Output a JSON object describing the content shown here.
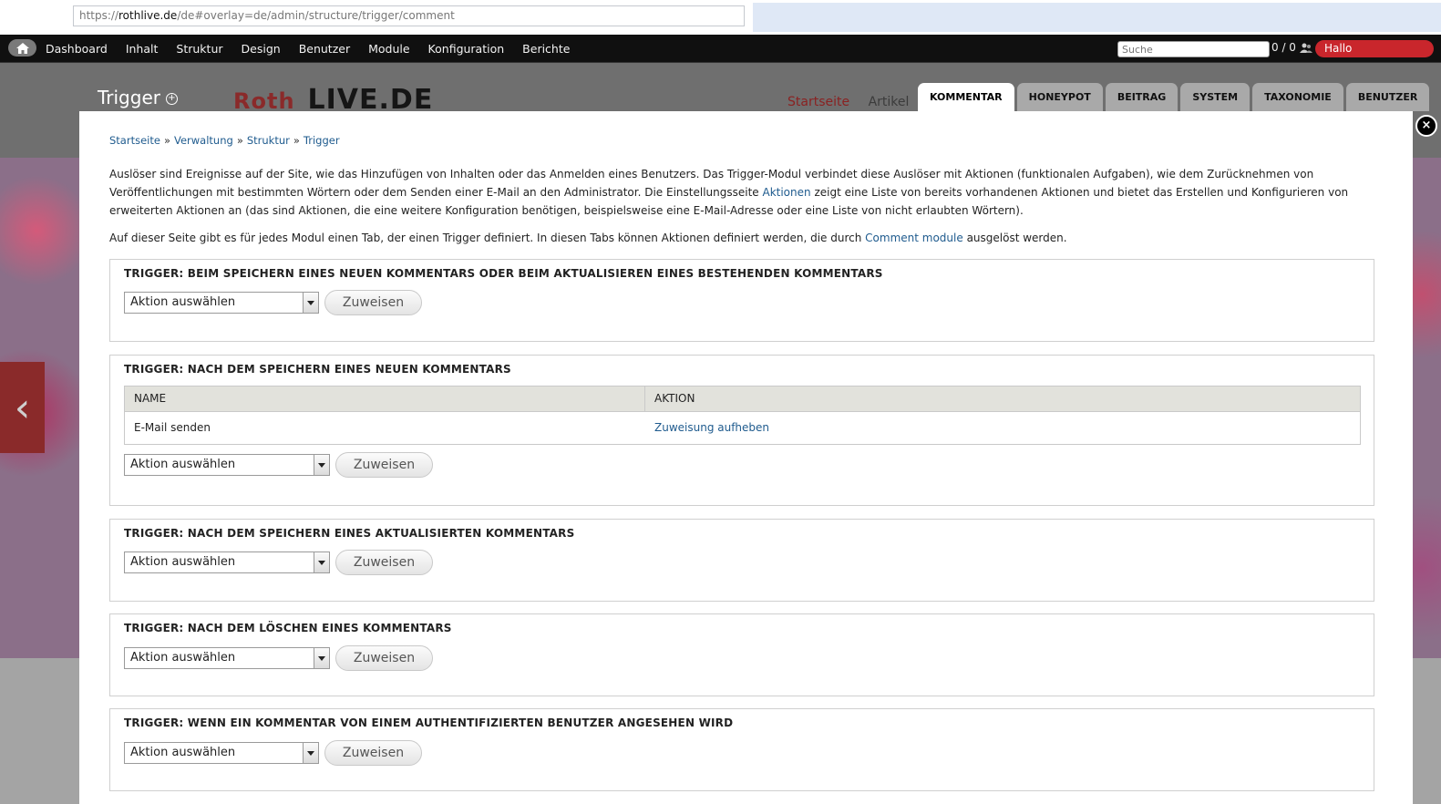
{
  "browser": {
    "url_scheme": "https://",
    "url_host": "rothlive.de",
    "url_path": "/de#overlay=de/admin/structure/trigger/comment"
  },
  "toolbar": {
    "home_icon": "home-icon",
    "menu": [
      "Dashboard",
      "Inhalt",
      "Struktur",
      "Design",
      "Benutzer",
      "Module",
      "Konfiguration",
      "Berichte"
    ],
    "search_placeholder": "Suche",
    "users_count": "0 / 0",
    "hello_label": "Hallo"
  },
  "site": {
    "logo_roth": "Roth",
    "logo_main": "LIVE.DE",
    "nav": [
      "Startseite",
      "Artikel"
    ]
  },
  "overlay": {
    "title": "Trigger",
    "tabs": [
      "KOMMENTAR",
      "HONEYPOT",
      "BEITRAG",
      "SYSTEM",
      "TAXONOMIE",
      "BENUTZER"
    ],
    "active_tab": "KOMMENTAR",
    "close_label": "×",
    "breadcrumb": [
      "Startseite",
      "Verwaltung",
      "Struktur",
      "Trigger"
    ],
    "breadcrumb_sep": "»",
    "intro": {
      "part1": "Auslöser sind Ereignisse auf der Site, wie das Hinzufügen von Inhalten oder das Anmelden eines Benutzers. Das Trigger-Modul verbindet diese Auslöser mit Aktionen (funktionalen Aufgaben), wie dem Zurücknehmen von Veröffentlichungen mit bestimmten Wörtern oder dem Senden einer E-Mail an den Administrator. Die Einstellungsseite ",
      "link": "Aktionen",
      "part2": " zeigt eine Liste von bereits vorhandenen Aktionen und bietet das Erstellen und Konfigurieren von erweiterten Aktionen an (das sind Aktionen, die eine weitere Konfiguration benötigen, beispielsweise eine E-Mail-Adresse oder eine Liste von nicht erlaubten Wörtern)."
    },
    "intro2": {
      "part1": "Auf dieser Seite gibt es für jedes Modul einen Tab, der einen Trigger definiert. In diesen Tabs können Aktionen definiert werden, die durch ",
      "link": "Comment module",
      "part2": " ausgelöst werden."
    },
    "select_label": "Aktion auswählen",
    "assign_label": "Zuweisen",
    "triggers": [
      {
        "legend": "TRIGGER: BEIM SPEICHERN EINES NEUEN KOMMENTARS ODER BEIM AKTUALISIEREN EINES BESTEHENDEN KOMMENTARS"
      },
      {
        "legend": "TRIGGER: NACH DEM SPEICHERN EINES NEUEN KOMMENTARS",
        "table": {
          "headers": [
            "NAME",
            "AKTION"
          ],
          "rows": [
            [
              "E-Mail senden",
              "Zuweisung aufheben"
            ]
          ]
        }
      },
      {
        "legend": "TRIGGER: NACH DEM SPEICHERN EINES AKTUALISIERTEN KOMMENTARS"
      },
      {
        "legend": "TRIGGER: NACH DEM LÖSCHEN EINES KOMMENTARS"
      },
      {
        "legend": "TRIGGER: WENN EIN KOMMENTAR VON EINEM AUTHENTIFIZIERTEN BENUTZER ANGESEHEN WIRD"
      }
    ]
  }
}
